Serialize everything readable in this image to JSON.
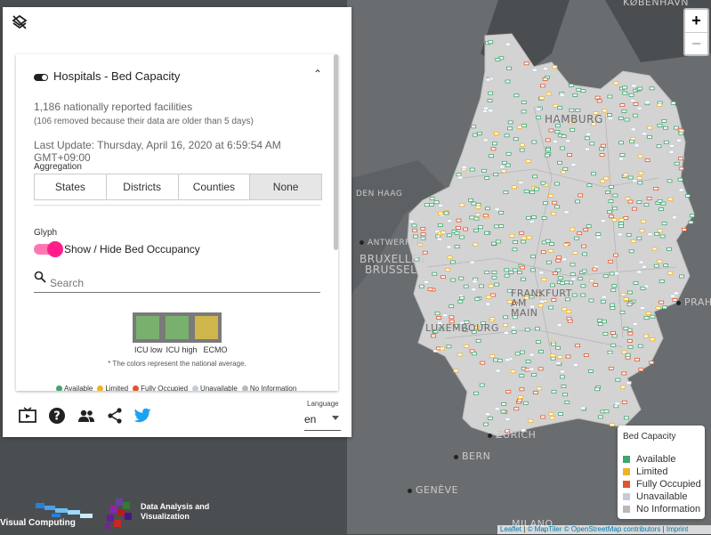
{
  "map": {
    "cities": [
      "KØBENHAVN",
      "HAMBURG",
      "ANTWERPEN",
      "BRUXELLES",
      "BRUSSEL",
      "PRAH",
      "FRANKFURT AM MAIN",
      "LUXEMBOURG",
      "ZÜRICH",
      "BERN",
      "GENÈVE",
      "MILANO",
      "DEN HAAG"
    ],
    "land_color": "#6b6e70",
    "germany_color": "#d6d6d6"
  },
  "panel": {
    "layer_icon": "layers-off-icon",
    "header_title": "Hospitals - Bed Capacity",
    "facilities_count": "1,186 nationally reported facilities",
    "removed_note": "(106 removed because their data are older than 5 days)",
    "last_update": "Last Update: Thursday, April 16, 2020 at 6:59:54 AM GMT+09:00",
    "aggregation_label": "Aggregation",
    "aggregation_options": [
      "States",
      "Districts",
      "Counties",
      "None"
    ],
    "aggregation_selected": "None",
    "glyph_label": "Glyph",
    "glyph_toggle_label": "Show / Hide Bed Occupancy",
    "search_placeholder": "Search",
    "glyph_legend": {
      "icu_low": "ICU low",
      "icu_high": "ICU high",
      "ecmo": "ECMO",
      "colors": [
        "#7ab06e",
        "#7ab06e",
        "#d0b54a"
      ],
      "note": "* The colors represent the national average."
    },
    "status_legend": [
      {
        "label": "Available",
        "color": "#3ea66f"
      },
      {
        "label": "Limited",
        "color": "#f0b323"
      },
      {
        "label": "Fully Occupied",
        "color": "#e1562c"
      },
      {
        "label": "Unavailable",
        "color": "#c4cdd6"
      },
      {
        "label": "No Information",
        "color": "#b9b9b9"
      }
    ],
    "language_label": "Language",
    "language_value": "en",
    "bottom_icons": [
      "tv-play-icon",
      "help-icon",
      "people-icon",
      "share-icon",
      "twitter-icon"
    ]
  },
  "zoom": {
    "in": "+",
    "out": "−"
  },
  "bed_legend": {
    "title": "Bed Capacity",
    "items": [
      {
        "label": "Available",
        "color": "#3ea66f"
      },
      {
        "label": "Limited",
        "color": "#f0b323"
      },
      {
        "label": "Fully Occupied",
        "color": "#e1562c"
      },
      {
        "label": "Unavailable",
        "color": "#c4cdd6"
      },
      {
        "label": "No Information",
        "color": "#b9b9b9"
      }
    ]
  },
  "attribution": {
    "leaflet": "Leaflet",
    "maptiler": "© MapTiler",
    "osm": "© OpenStreetMap contributors",
    "imprint": "Imprint"
  },
  "logos": {
    "visual_computing": "Visual Computing",
    "dav": "Data Analysis and Visualization"
  }
}
